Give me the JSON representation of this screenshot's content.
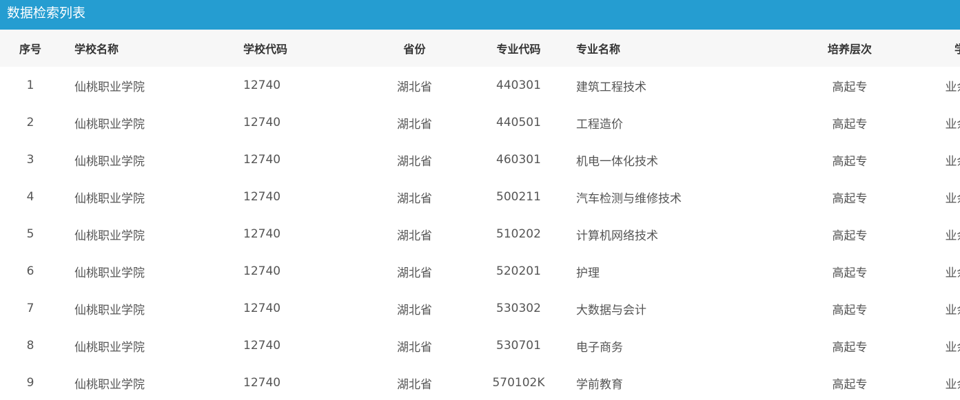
{
  "panel": {
    "title": "数据检索列表"
  },
  "table": {
    "headers": {
      "index": "序号",
      "school_name": "学校名称",
      "school_code": "学校代码",
      "province": "省份",
      "major_code": "专业代码",
      "major_name": "专业名称",
      "level": "培养层次",
      "study_mode": "学习形式"
    },
    "rows": [
      {
        "index": "1",
        "school_name": "仙桃职业学院",
        "school_code": "12740",
        "province": "湖北省",
        "major_code": "440301",
        "major_name": "建筑工程技术",
        "level": "高起专",
        "study_mode": "业余"
      },
      {
        "index": "2",
        "school_name": "仙桃职业学院",
        "school_code": "12740",
        "province": "湖北省",
        "major_code": "440501",
        "major_name": "工程造价",
        "level": "高起专",
        "study_mode": "业余"
      },
      {
        "index": "3",
        "school_name": "仙桃职业学院",
        "school_code": "12740",
        "province": "湖北省",
        "major_code": "460301",
        "major_name": "机电一体化技术",
        "level": "高起专",
        "study_mode": "业余"
      },
      {
        "index": "4",
        "school_name": "仙桃职业学院",
        "school_code": "12740",
        "province": "湖北省",
        "major_code": "500211",
        "major_name": "汽车检测与维修技术",
        "level": "高起专",
        "study_mode": "业余"
      },
      {
        "index": "5",
        "school_name": "仙桃职业学院",
        "school_code": "12740",
        "province": "湖北省",
        "major_code": "510202",
        "major_name": "计算机网络技术",
        "level": "高起专",
        "study_mode": "业余"
      },
      {
        "index": "6",
        "school_name": "仙桃职业学院",
        "school_code": "12740",
        "province": "湖北省",
        "major_code": "520201",
        "major_name": "护理",
        "level": "高起专",
        "study_mode": "业余"
      },
      {
        "index": "7",
        "school_name": "仙桃职业学院",
        "school_code": "12740",
        "province": "湖北省",
        "major_code": "530302",
        "major_name": "大数据与会计",
        "level": "高起专",
        "study_mode": "业余"
      },
      {
        "index": "8",
        "school_name": "仙桃职业学院",
        "school_code": "12740",
        "province": "湖北省",
        "major_code": "530701",
        "major_name": "电子商务",
        "level": "高起专",
        "study_mode": "业余"
      },
      {
        "index": "9",
        "school_name": "仙桃职业学院",
        "school_code": "12740",
        "province": "湖北省",
        "major_code": "570102K",
        "major_name": "学前教育",
        "level": "高起专",
        "study_mode": "业余"
      }
    ]
  },
  "colors": {
    "title_bar": "#259dd1",
    "header_row": "#f7f7f7"
  }
}
